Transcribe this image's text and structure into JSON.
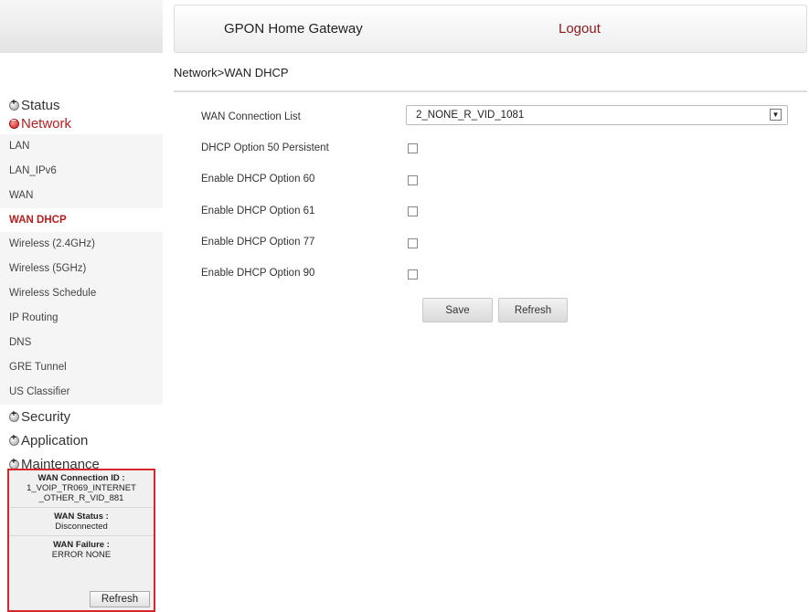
{
  "header": {
    "title": "GPON Home Gateway",
    "logout": "Logout"
  },
  "breadcrumb": "Network>WAN DHCP",
  "sidebar": {
    "status": "Status",
    "network": "Network",
    "network_items": [
      "LAN",
      "LAN_IPv6",
      "WAN",
      "WAN DHCP",
      "Wireless (2.4GHz)",
      "Wireless (5GHz)",
      "Wireless Schedule",
      "IP Routing",
      "DNS",
      "GRE Tunnel",
      "US Classifier"
    ],
    "security": "Security",
    "application": "Application",
    "maintenance": "Maintenance"
  },
  "status_box": {
    "conn_id_label": "WAN Connection ID :",
    "conn_id_value": "1_VOIP_TR069_INTERNET _OTHER_R_VID_881",
    "wan_status_label": "WAN Status :",
    "wan_status_value": "Disconnected",
    "wan_failure_label": "WAN Failure :",
    "wan_failure_value": "ERROR NONE",
    "refresh": "Refresh"
  },
  "form": {
    "conn_list_label": "WAN Connection List",
    "conn_list_value": "2_NONE_R_VID_1081",
    "opt50": "DHCP Option 50 Persistent",
    "opt60": "Enable DHCP Option 60",
    "opt61": "Enable DHCP Option 61",
    "opt77": "Enable DHCP Option 77",
    "opt90": "Enable DHCP Option 90",
    "save": "Save",
    "refresh": "Refresh"
  }
}
